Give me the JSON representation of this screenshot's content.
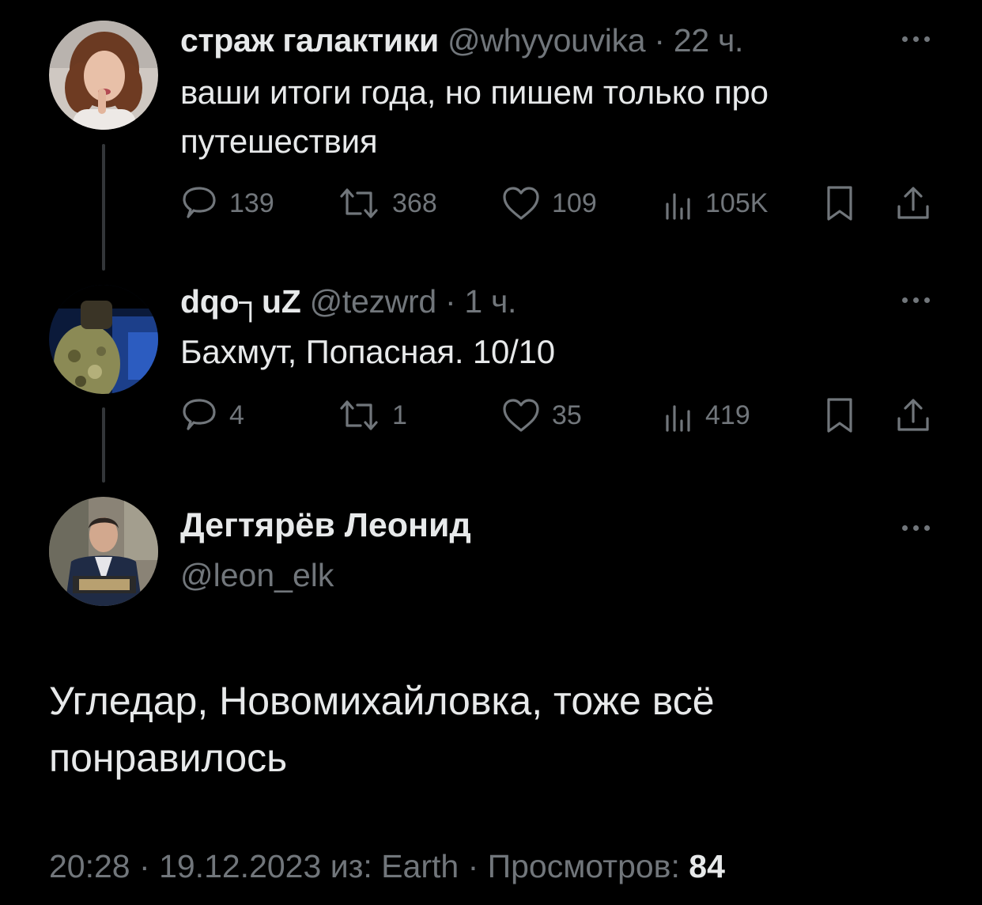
{
  "tweets": [
    {
      "name": "страж галактики",
      "handle": "@whyyouvika",
      "separator": "·",
      "time": "22 ч.",
      "text_line1": "ваши итоги года, но пишем только про",
      "text_line2": "путешествия",
      "replies": "139",
      "retweets": "368",
      "likes": "109",
      "views": "105K"
    },
    {
      "name": "dqo┐uZ",
      "handle": "@tezwrd",
      "separator": "·",
      "time": "1 ч.",
      "text_line1": "Бахмут, Попасная. 10/10",
      "replies": "4",
      "retweets": "1",
      "likes": "35",
      "views": "419"
    }
  ],
  "main_tweet": {
    "name": "Дегтярёв Леонид",
    "handle": "@leon_elk",
    "text_line1": "Угледар, Новомихайловка, тоже всё",
    "text_line2": "понравилось",
    "meta_time": "20:28",
    "meta_sep1": "·",
    "meta_date": "19.12.2023",
    "meta_source": "из: Earth",
    "meta_sep2": "·",
    "meta_views_label": "Просмотров:",
    "meta_views_value": "84"
  },
  "icons": {
    "reply": "reply-icon",
    "retweet": "retweet-icon",
    "like": "heart-icon",
    "views": "views-chart-icon",
    "bookmark": "bookmark-icon",
    "share": "share-icon",
    "more": "more-dots-icon"
  },
  "colors": {
    "background": "#000000",
    "text": "#e7e9ea",
    "muted": "#71767b",
    "thread_line": "#333639"
  }
}
